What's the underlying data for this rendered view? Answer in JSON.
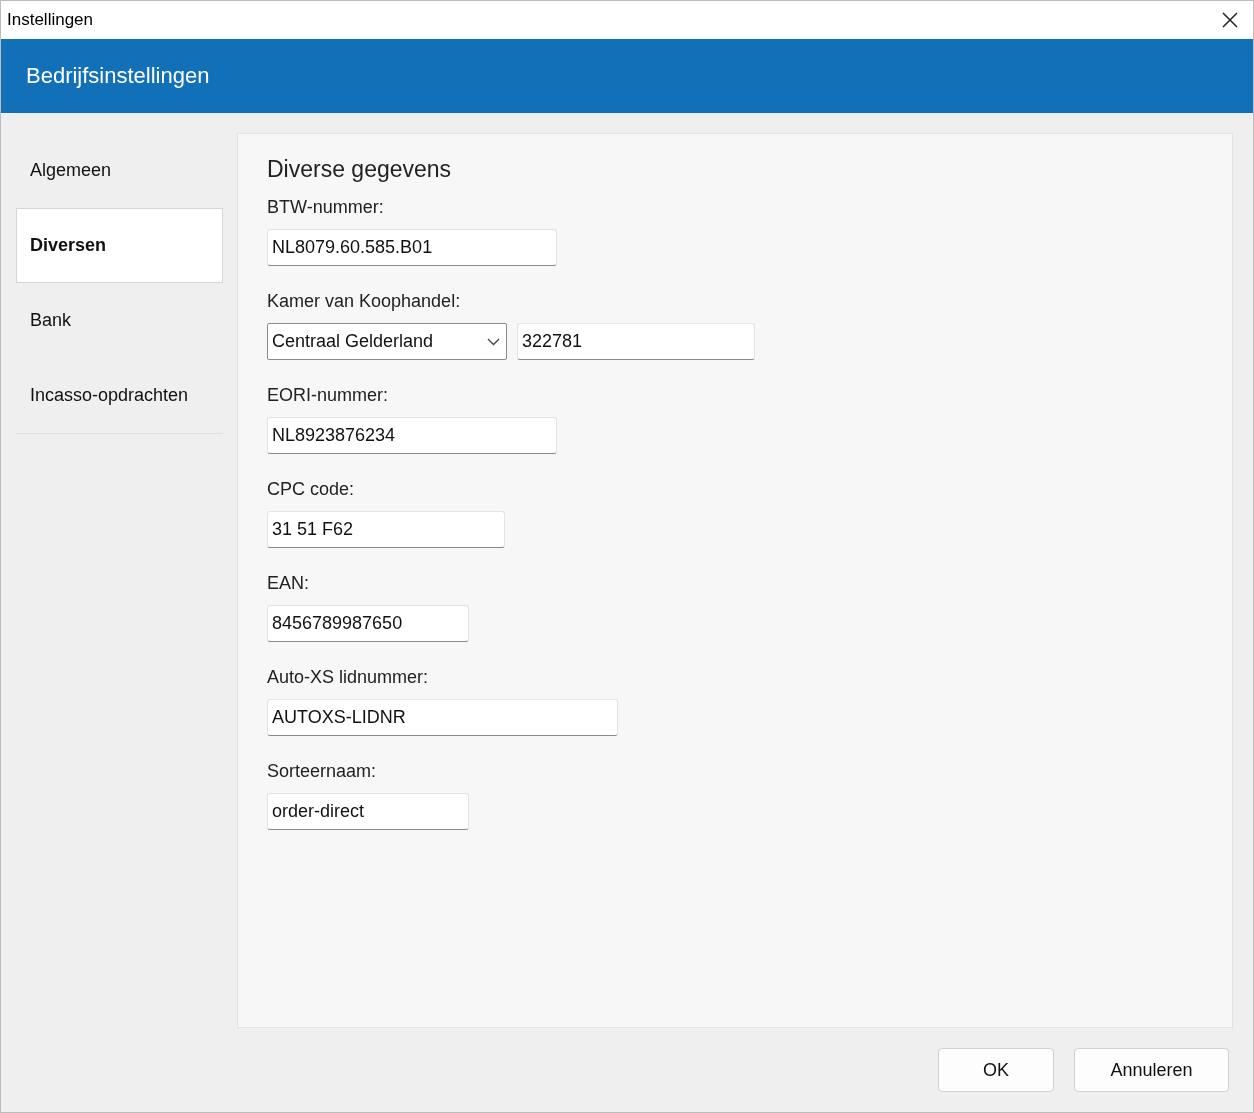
{
  "window": {
    "title": "Instellingen"
  },
  "header": {
    "title": "Bedrijfsinstellingen"
  },
  "sidebar": {
    "items": [
      {
        "label": "Algemeen",
        "selected": false
      },
      {
        "label": "Diversen",
        "selected": true
      },
      {
        "label": "Bank",
        "selected": false
      },
      {
        "label": "Incasso-opdrachten",
        "selected": false
      }
    ]
  },
  "section": {
    "title": "Diverse gegevens",
    "fields": [
      {
        "kind": "text",
        "label": "BTW-nummer:",
        "value": "NL8079.60.585.B01"
      },
      {
        "kind": "select_text",
        "label": "Kamer van Koophandel:",
        "select_value": "Centraal Gelderland",
        "value": "322781"
      },
      {
        "kind": "text",
        "label": "EORI-nummer:",
        "value": "NL8923876234"
      },
      {
        "kind": "text",
        "label": "CPC code:",
        "value": "31 51 F62"
      },
      {
        "kind": "text",
        "label": "EAN:",
        "value": "8456789987650"
      },
      {
        "kind": "text",
        "label": "Auto-XS lidnummer:",
        "value": "AUTOXS-LIDNR"
      },
      {
        "kind": "text",
        "label": "Sorteernaam:",
        "value": "order-direct"
      }
    ]
  },
  "buttons": [
    {
      "label": "OK"
    },
    {
      "label": "Annuleren"
    }
  ]
}
